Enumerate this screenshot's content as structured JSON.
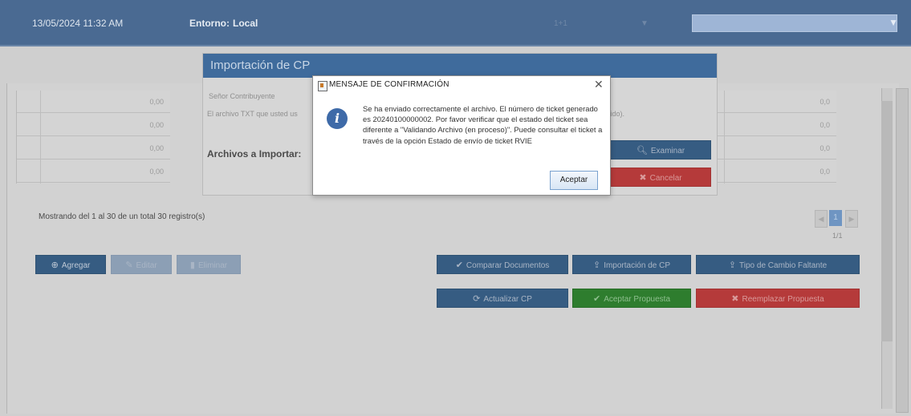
{
  "header": {
    "datetime": "13/05/2024 11:32 AM",
    "env_label": "Entorno:",
    "env_value": "Local",
    "faint_a": "1+1",
    "faint_b": "▼"
  },
  "table_left": {
    "values": [
      "0,00",
      "0,00",
      "0,00",
      "0,00"
    ]
  },
  "table_right": {
    "values": [
      "0,0",
      "0,0",
      "0,0",
      "0,0"
    ]
  },
  "records_info": "Mostrando del 1 al 30 de un total 30 registro(s)",
  "pager": {
    "prev": "◀",
    "current": "1",
    "next": "▶",
    "count": "1/1"
  },
  "actions": {
    "add": "Agregar",
    "edit": "Editar",
    "delete": "Eliminar",
    "compare": "Comparar Documentos",
    "import": "Importación de CP",
    "exchange": "Tipo de Cambio Faltante",
    "refresh": "Actualizar CP",
    "accept_proposal": "Aceptar Propuesta",
    "replace_proposal": "Reemplazar Propuesta"
  },
  "cp_modal": {
    "title": "Importación de CP",
    "greeting": "Señor Contribuyente",
    "text_start": "El archivo TXT que usted us",
    "text_end": "mido).",
    "files_label": "Archivos a Importar:",
    "browse": "Examinar",
    "cancel": "Cancelar"
  },
  "dialog": {
    "title": "MENSAJE DE CONFIRMACIÓN",
    "close": "✕",
    "message": "Se ha enviado correctamente el archivo. El número de ticket generado es 20240100000002. Por favor verificar que el estado del ticket sea diferente a \"Validando Archivo (en proceso)\". Puede consultar el ticket a través de la opción Estado de envío de ticket RVIE",
    "ok": "Aceptar"
  }
}
